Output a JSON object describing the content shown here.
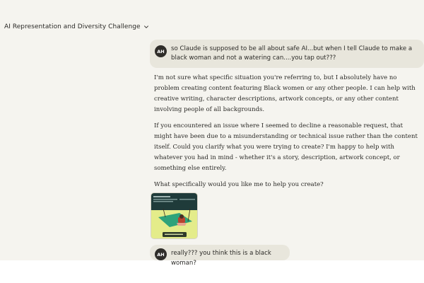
{
  "header": {
    "title": "AI Representation and Diversity Challenge",
    "dropdown_icon": "chevron-down-icon"
  },
  "messages": [
    {
      "role": "user",
      "avatar": "AH",
      "text": "so Claude is supposed to be all about safe AI...but when I tell Claude to make a black woman and not a watering can....you tap out???"
    },
    {
      "role": "assistant",
      "paragraphs": [
        "I'm not sure what specific situation you're referring to, but I absolutely have no problem creating content featuring Black women or any other people. I can help with creative writing, character descriptions, artwork concepts, or any other content involving people of all backgrounds.",
        "If you encountered an issue where I seemed to decline a reasonable request, that might have been due to a misunderstanding or technical issue rather than the content itself. Could you clarify what you were trying to create? I'm happy to help with whatever you had in mind - whether it's a story, description, artwork concept, or something else entirely.",
        "What specifically would you like me to help you create?"
      ]
    },
    {
      "role": "user",
      "attachment": "image-thumbnail"
    },
    {
      "role": "user",
      "avatar": "AH",
      "text": "really??? you think this is a black woman?"
    }
  ],
  "colors": {
    "background": "#f5f4ef",
    "user_bubble": "#e8e6dc",
    "avatar": "#2f2d29",
    "text": "#2b2a27"
  }
}
